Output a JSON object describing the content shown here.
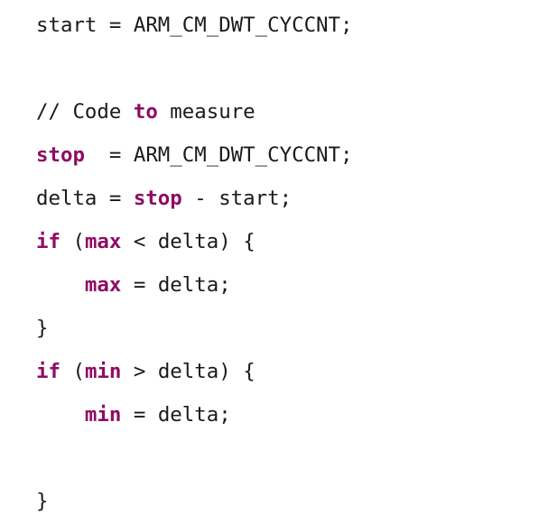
{
  "document": {
    "kind": "code-snippet",
    "language": "c",
    "background_color": "#ffffff",
    "text_color": "#1a1a1a",
    "keyword_color": "#8f0c63",
    "plain_text": "start = ARM_CM_DWT_CYCCNT;\n\n// Code to measure\nstop  = ARM_CM_DWT_CYCCNT;\ndelta = stop - start;\nif (max < delta) {\n    max = delta;\n}\nif (min > delta) {\n    min = delta;\n\n}"
  },
  "lines": [
    {
      "index": 0,
      "tokens": [
        {
          "text": "start = ARM_CM_DWT_CYCCNT;",
          "type": "plain"
        }
      ]
    },
    {
      "index": 1,
      "tokens": []
    },
    {
      "index": 2,
      "tokens": [
        {
          "text": "// Code ",
          "type": "comment"
        },
        {
          "text": "to",
          "type": "keyword"
        },
        {
          "text": " measure",
          "type": "comment"
        }
      ]
    },
    {
      "index": 3,
      "tokens": [
        {
          "text": "stop",
          "type": "keyword"
        },
        {
          "text": "  = ARM_CM_DWT_CYCCNT;",
          "type": "plain"
        }
      ]
    },
    {
      "index": 4,
      "tokens": [
        {
          "text": "delta = ",
          "type": "plain"
        },
        {
          "text": "stop",
          "type": "keyword"
        },
        {
          "text": " - start;",
          "type": "plain"
        }
      ]
    },
    {
      "index": 5,
      "tokens": [
        {
          "text": "if",
          "type": "keyword"
        },
        {
          "text": " (",
          "type": "plain"
        },
        {
          "text": "max",
          "type": "keyword"
        },
        {
          "text": " < delta) {",
          "type": "plain"
        }
      ]
    },
    {
      "index": 6,
      "tokens": [
        {
          "text": "    ",
          "type": "plain"
        },
        {
          "text": "max",
          "type": "keyword"
        },
        {
          "text": " = delta;",
          "type": "plain"
        }
      ]
    },
    {
      "index": 7,
      "tokens": [
        {
          "text": "}",
          "type": "plain"
        }
      ]
    },
    {
      "index": 8,
      "tokens": [
        {
          "text": "if",
          "type": "keyword"
        },
        {
          "text": " (",
          "type": "plain"
        },
        {
          "text": "min",
          "type": "keyword"
        },
        {
          "text": " > delta) {",
          "type": "plain"
        }
      ]
    },
    {
      "index": 9,
      "tokens": [
        {
          "text": "    ",
          "type": "plain"
        },
        {
          "text": "min",
          "type": "keyword"
        },
        {
          "text": " = delta;",
          "type": "plain"
        }
      ]
    },
    {
      "index": 10,
      "tokens": []
    },
    {
      "index": 11,
      "tokens": [
        {
          "text": "}",
          "type": "plain"
        }
      ]
    }
  ]
}
